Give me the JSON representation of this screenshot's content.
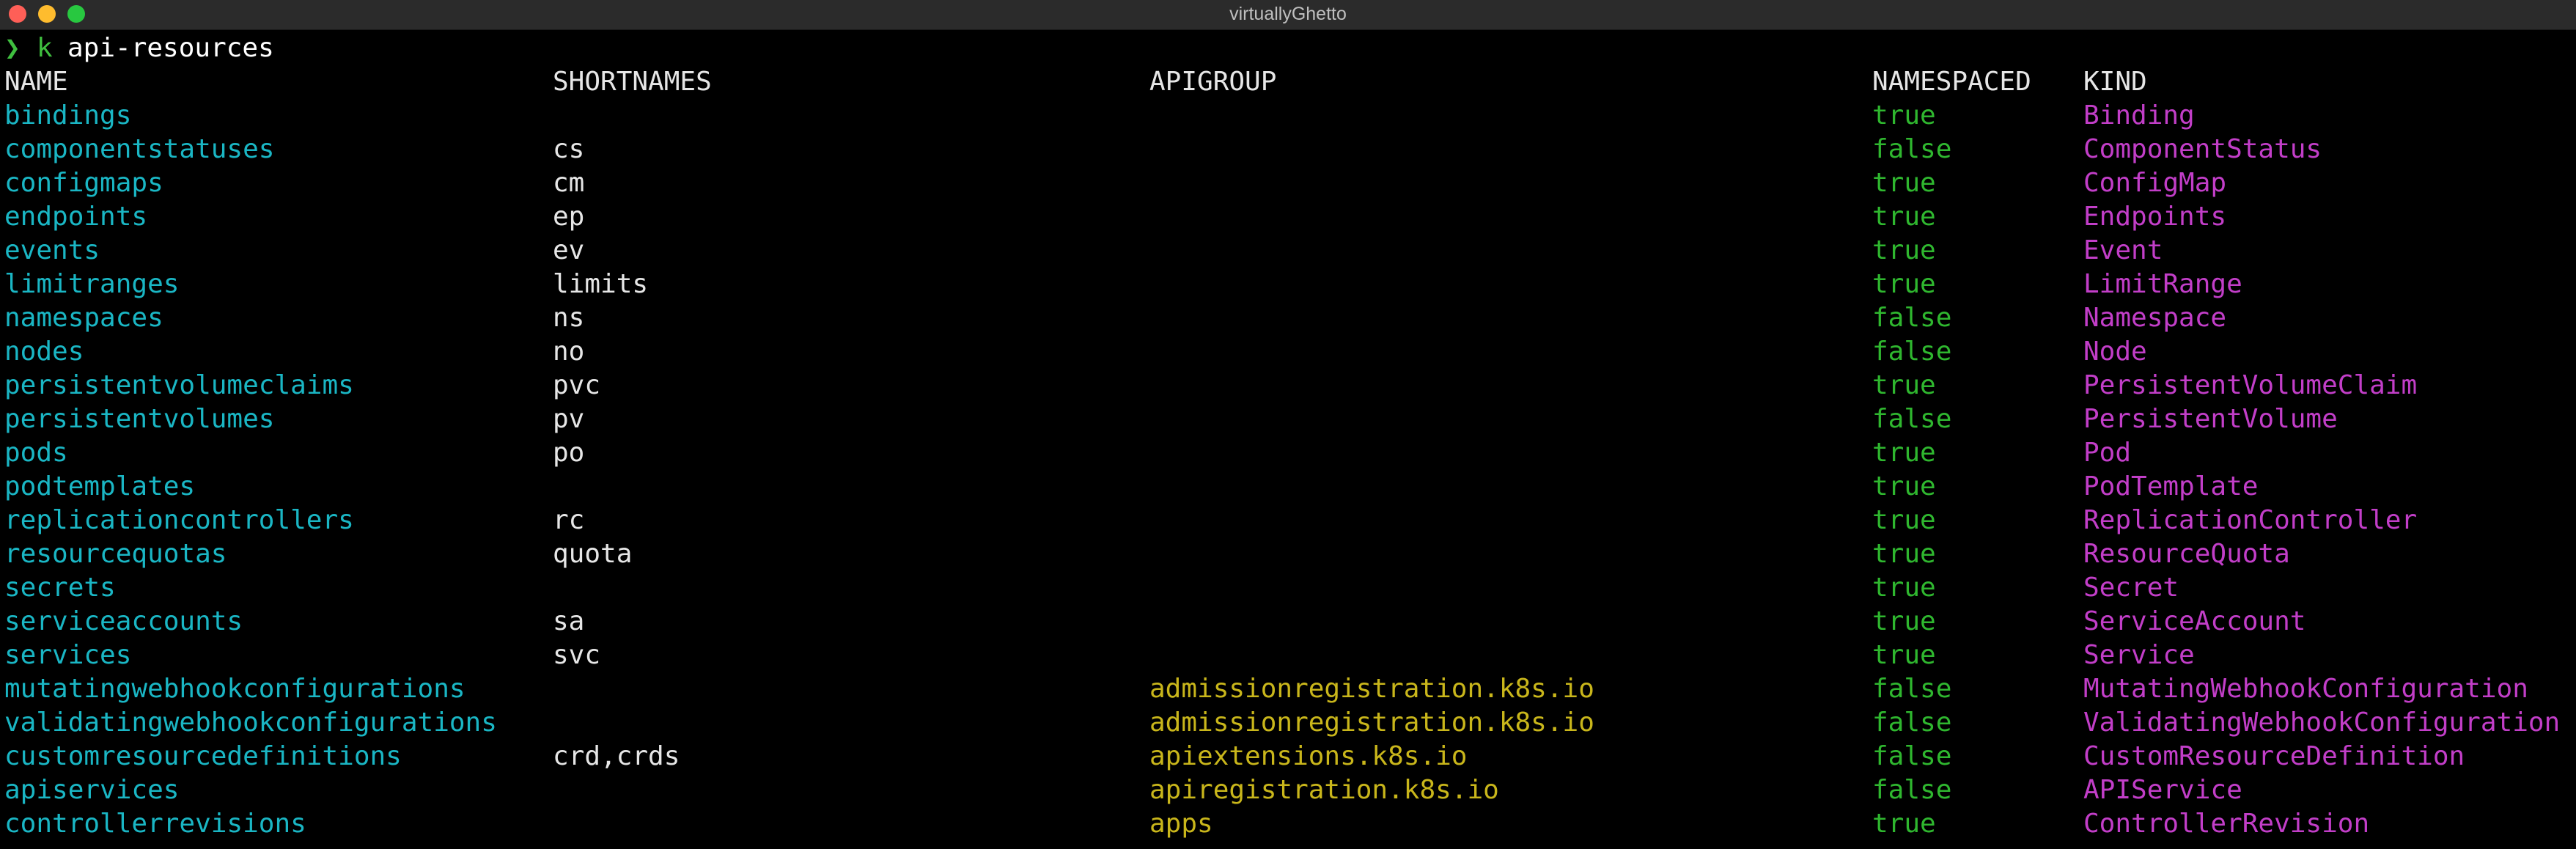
{
  "window": {
    "title": "virtuallyGhetto"
  },
  "prompt": {
    "symbol": "❯",
    "alias": "k",
    "command": "api-resources"
  },
  "table": {
    "headers": {
      "name": "NAME",
      "shortnames": "SHORTNAMES",
      "apigroup": "APIGROUP",
      "namespaced": "NAMESPACED",
      "kind": "KIND"
    },
    "rows": [
      {
        "name": "bindings",
        "shortnames": "",
        "apigroup": "",
        "namespaced": "true",
        "kind": "Binding"
      },
      {
        "name": "componentstatuses",
        "shortnames": "cs",
        "apigroup": "",
        "namespaced": "false",
        "kind": "ComponentStatus"
      },
      {
        "name": "configmaps",
        "shortnames": "cm",
        "apigroup": "",
        "namespaced": "true",
        "kind": "ConfigMap"
      },
      {
        "name": "endpoints",
        "shortnames": "ep",
        "apigroup": "",
        "namespaced": "true",
        "kind": "Endpoints"
      },
      {
        "name": "events",
        "shortnames": "ev",
        "apigroup": "",
        "namespaced": "true",
        "kind": "Event"
      },
      {
        "name": "limitranges",
        "shortnames": "limits",
        "apigroup": "",
        "namespaced": "true",
        "kind": "LimitRange"
      },
      {
        "name": "namespaces",
        "shortnames": "ns",
        "apigroup": "",
        "namespaced": "false",
        "kind": "Namespace"
      },
      {
        "name": "nodes",
        "shortnames": "no",
        "apigroup": "",
        "namespaced": "false",
        "kind": "Node"
      },
      {
        "name": "persistentvolumeclaims",
        "shortnames": "pvc",
        "apigroup": "",
        "namespaced": "true",
        "kind": "PersistentVolumeClaim"
      },
      {
        "name": "persistentvolumes",
        "shortnames": "pv",
        "apigroup": "",
        "namespaced": "false",
        "kind": "PersistentVolume"
      },
      {
        "name": "pods",
        "shortnames": "po",
        "apigroup": "",
        "namespaced": "true",
        "kind": "Pod"
      },
      {
        "name": "podtemplates",
        "shortnames": "",
        "apigroup": "",
        "namespaced": "true",
        "kind": "PodTemplate"
      },
      {
        "name": "replicationcontrollers",
        "shortnames": "rc",
        "apigroup": "",
        "namespaced": "true",
        "kind": "ReplicationController"
      },
      {
        "name": "resourcequotas",
        "shortnames": "quota",
        "apigroup": "",
        "namespaced": "true",
        "kind": "ResourceQuota"
      },
      {
        "name": "secrets",
        "shortnames": "",
        "apigroup": "",
        "namespaced": "true",
        "kind": "Secret"
      },
      {
        "name": "serviceaccounts",
        "shortnames": "sa",
        "apigroup": "",
        "namespaced": "true",
        "kind": "ServiceAccount"
      },
      {
        "name": "services",
        "shortnames": "svc",
        "apigroup": "",
        "namespaced": "true",
        "kind": "Service"
      },
      {
        "name": "mutatingwebhookconfigurations",
        "shortnames": "",
        "apigroup": "admissionregistration.k8s.io",
        "namespaced": "false",
        "kind": "MutatingWebhookConfiguration"
      },
      {
        "name": "validatingwebhookconfigurations",
        "shortnames": "",
        "apigroup": "admissionregistration.k8s.io",
        "namespaced": "false",
        "kind": "ValidatingWebhookConfiguration"
      },
      {
        "name": "customresourcedefinitions",
        "shortnames": "crd,crds",
        "apigroup": "apiextensions.k8s.io",
        "namespaced": "false",
        "kind": "CustomResourceDefinition"
      },
      {
        "name": "apiservices",
        "shortnames": "",
        "apigroup": "apiregistration.k8s.io",
        "namespaced": "false",
        "kind": "APIService"
      },
      {
        "name": "controllerrevisions",
        "shortnames": "",
        "apigroup": "apps",
        "namespaced": "true",
        "kind": "ControllerRevision"
      }
    ]
  },
  "colors": {
    "background": "#000000",
    "titlebar": "#2b2b2b",
    "name": "#1ab6c4",
    "apigroup": "#c9b61b",
    "namespaced": "#2fb72f",
    "kind": "#c23ec8",
    "prompt": "#3fbf3f"
  }
}
